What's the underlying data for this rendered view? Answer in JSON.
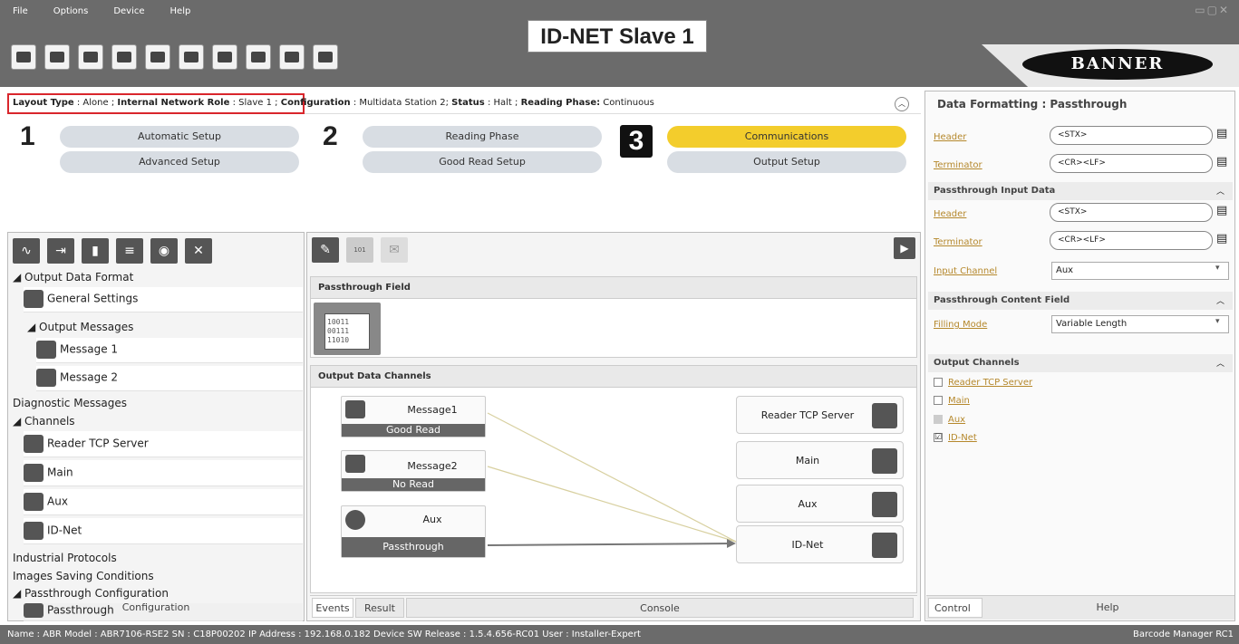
{
  "menu": [
    "File",
    "Options",
    "Device",
    "Help"
  ],
  "window_title": "ID-NET Slave 1",
  "logo_text": "BANNER",
  "info": {
    "layout_type_label": "Layout Type",
    "layout_type": ": Alone ;",
    "role_label": "Internal Network Role",
    "role": ": Slave 1 ;",
    "config_label": "Configuration",
    "config": ": Multidata Station 2;",
    "status_label": "Status",
    "status": ": Halt ;",
    "phase_label": "Reading Phase:",
    "phase": "Continuous"
  },
  "steps": {
    "n1": "1",
    "n2": "2",
    "n3": "3",
    "automatic_setup": "Automatic Setup",
    "advanced_setup": "Advanced Setup",
    "reading_phase": "Reading Phase",
    "good_read_setup": "Good Read Setup",
    "communications": "Communications",
    "output_setup": "Output Setup"
  },
  "tree": {
    "output_data_format": "◢ Output Data Format",
    "general_settings": "General Settings",
    "output_messages": "◢ Output Messages",
    "message1": "Message 1",
    "message2": "Message 2",
    "diagnostic_messages": "Diagnostic Messages",
    "channels": "◢ Channels",
    "reader_tcp_server": "Reader TCP Server",
    "main": "Main",
    "aux": "Aux",
    "id_net": "ID-Net",
    "industrial_protocols": "Industrial Protocols",
    "images_saving": "Images Saving Conditions",
    "passthrough_config": "◢ Passthrough Configuration",
    "passthrough": "Passthrough",
    "footer": "Configuration"
  },
  "center": {
    "passthrough_field": "Passthrough Field",
    "bin_text": "10011\n00111\n11010",
    "output_data_channels": "Output Data Channels",
    "message1_label": "Message1",
    "message1_status": "Good Read",
    "message2_label": "Message2",
    "message2_status": "No Read",
    "aux_label": "Aux",
    "aux_status": "Passthrough",
    "ch_reader_tcp": "Reader TCP Server",
    "ch_main": "Main",
    "ch_aux": "Aux",
    "ch_idnet": "ID-Net",
    "tab_events": "Events",
    "tab_result": "Result",
    "tab_console": "Console"
  },
  "right": {
    "title": "Data Formatting : Passthrough",
    "header_label": "Header",
    "header_value": "<STX>",
    "terminator_label": "Terminator",
    "terminator_value": "<CR><LF>",
    "input_data_section": "Passthrough Input Data",
    "in_header_label": "Header",
    "in_header_value": "<STX>",
    "in_terminator_label": "Terminator",
    "in_terminator_value": "<CR><LF>",
    "input_channel_label": "Input Channel",
    "input_channel_value": "Aux",
    "content_section": "Passthrough Content Field",
    "filling_mode_label": "Filling Mode",
    "filling_mode_value": "Variable Length",
    "output_channels_section": "Output Channels",
    "oc_reader_tcp": "Reader TCP Server",
    "oc_main": "Main",
    "oc_aux": "Aux",
    "oc_idnet": "ID-Net",
    "oc_idnet_checked": "☑",
    "tab_control": "Control",
    "tab_help": "Help"
  },
  "statusbar": {
    "left": "Name : ABR  Model : ABR7106-RSE2  SN : C18P00202  IP Address : 192.168.0.182  Device SW Release : 1.5.4.656-RC01  User : Installer-Expert",
    "right": "Barcode Manager RC1"
  },
  "colors": {
    "accent": "#f3cd2c",
    "frame": "#6b6b6b",
    "highlight_border": "#d9262c",
    "link": "#b5882c"
  }
}
